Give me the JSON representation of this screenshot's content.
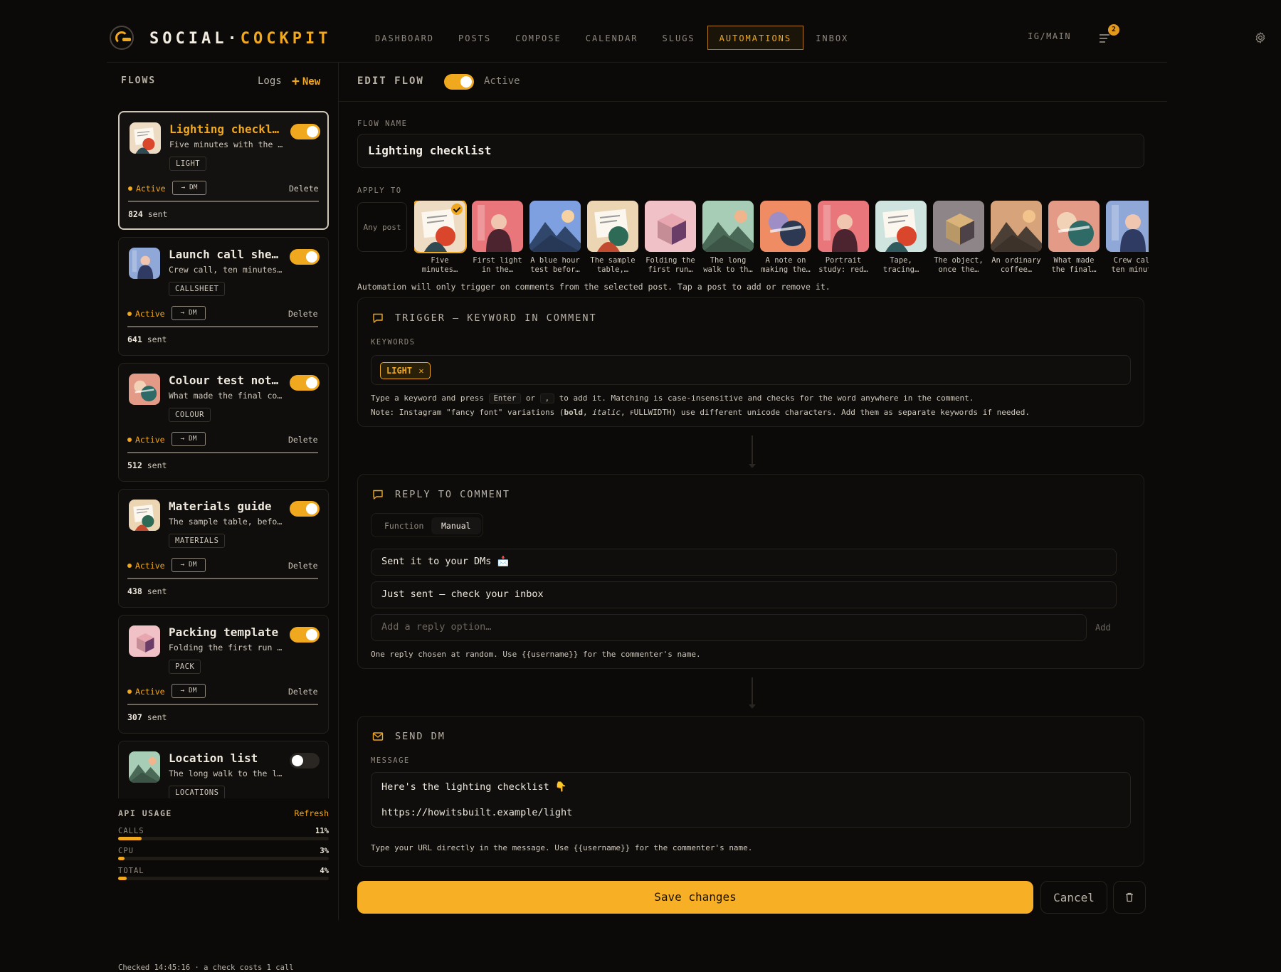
{
  "app": {
    "brand_a": "SOCIAL·",
    "brand_b": "COCKPIT",
    "account": "IG/MAIN",
    "notifications": "2"
  },
  "nav": [
    {
      "label": "DASHBOARD"
    },
    {
      "label": "POSTS"
    },
    {
      "label": "COMPOSE"
    },
    {
      "label": "CALENDAR"
    },
    {
      "label": "SLUGS"
    },
    {
      "label": "AUTOMATIONS",
      "active": true
    },
    {
      "label": "INBOX"
    }
  ],
  "sidebar": {
    "title": "FLOWS",
    "logs": "Logs",
    "new": "New",
    "flows": [
      {
        "title": "Lighting checkl…",
        "desc": "Five minutes with the …",
        "tag": "LIGHT",
        "status": "Active",
        "dm": "→ DM",
        "delete": "Delete",
        "sent": "824",
        "sent_label": "sent",
        "enabled": true,
        "selected": true,
        "thumb": "doc"
      },
      {
        "title": "Launch call she…",
        "desc": "Crew call, ten minutes…",
        "tag": "CALLSHEET",
        "status": "Active",
        "dm": "→ DM",
        "delete": "Delete",
        "sent": "641",
        "sent_label": "sent",
        "enabled": true,
        "thumb": "figure-blue"
      },
      {
        "title": "Colour test not…",
        "desc": "What made the final co…",
        "tag": "COLOUR",
        "status": "Active",
        "dm": "→ DM",
        "delete": "Delete",
        "sent": "512",
        "sent_label": "sent",
        "enabled": true,
        "thumb": "circles"
      },
      {
        "title": "Materials guide",
        "desc": "The sample table, befo…",
        "tag": "MATERIALS",
        "status": "Active",
        "dm": "→ DM",
        "delete": "Delete",
        "sent": "438",
        "sent_label": "sent",
        "enabled": true,
        "thumb": "doc-green"
      },
      {
        "title": "Packing template",
        "desc": "Folding the first run …",
        "tag": "PACK",
        "status": "Active",
        "dm": "→ DM",
        "delete": "Delete",
        "sent": "307",
        "sent_label": "sent",
        "enabled": true,
        "thumb": "box"
      },
      {
        "title": "Location list",
        "desc": "The long walk to the l…",
        "tag": "LOCATIONS",
        "status": "",
        "dm": "",
        "delete": "",
        "sent": "",
        "sent_label": "",
        "enabled": false,
        "thumb": "mountain"
      }
    ]
  },
  "api": {
    "title": "API USAGE",
    "refresh": "Refresh",
    "meters": [
      {
        "label": "CALLS",
        "pct": "11%",
        "value": 0.11
      },
      {
        "label": "CPU",
        "pct": "3%",
        "value": 0.03
      },
      {
        "label": "TOTAL",
        "pct": "4%",
        "value": 0.04
      }
    ],
    "checked": "Checked 14:45:16 · a check costs 1 call"
  },
  "editor": {
    "title": "EDIT FLOW",
    "active_label": "Active",
    "flow_name_label": "FLOW NAME",
    "flow_name": "Lighting checklist",
    "apply_to_label": "APPLY TO",
    "any_post": "Any post",
    "apply_hint": "Automation will only trigger on comments from the selected post. Tap a post to add or remove it.",
    "posts": [
      {
        "cap1": "Five",
        "cap2": "minutes…",
        "art": "doc",
        "selected": true
      },
      {
        "cap1": "First light",
        "cap2": "in the…",
        "art": "figure-red"
      },
      {
        "cap1": "A blue hour",
        "cap2": "test befor…",
        "art": "mountain-blue"
      },
      {
        "cap1": "The sample",
        "cap2": "table,…",
        "art": "doc-green"
      },
      {
        "cap1": "Folding the",
        "cap2": "first run…",
        "art": "box"
      },
      {
        "cap1": "The long",
        "cap2": "walk to th…",
        "art": "mountain"
      },
      {
        "cap1": "A note on",
        "cap2": "making the…",
        "art": "circles-dark"
      },
      {
        "cap1": "Portrait",
        "cap2": "study: red…",
        "art": "figure-red"
      },
      {
        "cap1": "Tape,",
        "cap2": "tracing…",
        "art": "doc-teal"
      },
      {
        "cap1": "The object,",
        "cap2": "once the…",
        "art": "box-grey"
      },
      {
        "cap1": "An ordinary",
        "cap2": "coffee…",
        "art": "mountain-warm"
      },
      {
        "cap1": "What made",
        "cap2": "the final…",
        "art": "circles"
      },
      {
        "cap1": "Crew cal",
        "cap2": "ten minut",
        "art": "figure-blue"
      }
    ]
  },
  "trigger": {
    "title": "TRIGGER — KEYWORD IN COMMENT",
    "keywords_label": "KEYWORDS",
    "keyword": "LIGHT",
    "hint_a": "Type a keyword and press",
    "hint_key1": "Enter",
    "hint_or": "or",
    "hint_key2": ",",
    "hint_b": "to add it. Matching is case-insensitive and checks for the word anywhere in the comment.",
    "note_a": "Note: Instagram \"fancy font\" variations (",
    "note_bold": "bold",
    "note_sep": ", ",
    "note_italic": "italic",
    "note_c": ", ꜰULLWIDTH) use different unicode characters. Add them as separate keywords if needed."
  },
  "reply": {
    "title": "REPLY TO COMMENT",
    "tab_function": "Function",
    "tab_manual": "Manual",
    "options": [
      "Sent it to your DMs 📩",
      "Just sent — check your inbox"
    ],
    "placeholder": "Add a reply option…",
    "add": "Add",
    "hint": "One reply chosen at random. Use {{username}} for the commenter's name."
  },
  "dm": {
    "title": "SEND DM",
    "message_label": "MESSAGE",
    "line1": "Here's the lighting checklist 👇",
    "line2": "https://howitsbuilt.example/light",
    "hint": "Type your URL directly in the message. Use {{username}} for the commenter's name."
  },
  "actions": {
    "save": "Save changes",
    "cancel": "Cancel"
  },
  "colors": {
    "accent": "#f0a81e",
    "bg": "#0b0a09"
  }
}
